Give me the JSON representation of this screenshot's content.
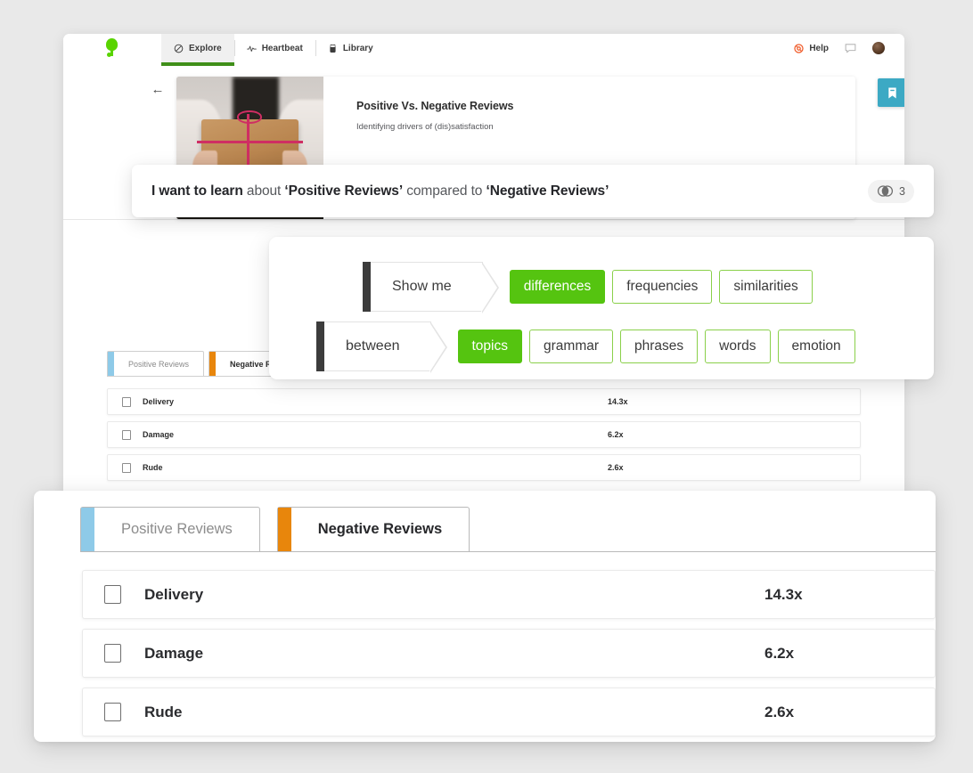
{
  "topnav": {
    "logo_name": "thematic-logo",
    "tabs": [
      {
        "label": "Explore",
        "icon": "explore-icon",
        "active": true
      },
      {
        "label": "Heartbeat",
        "icon": "heartbeat-icon",
        "active": false
      },
      {
        "label": "Library",
        "icon": "library-icon",
        "active": false
      }
    ],
    "help_label": "Help",
    "help_icon": "help-lifebuoy-icon",
    "feedback_icon": "chat-bubble-icon",
    "avatar_name": "user-avatar"
  },
  "hero": {
    "back_icon": "back-arrow-icon",
    "thumbnail_name": "hands-holding-wrapped-parcel-photo",
    "title": "Positive Vs. Negative Reviews",
    "subtitle": "Identifying drivers of (dis)satisfaction",
    "bookmark_icon": "bookmark-icon"
  },
  "query": {
    "lead": "I want to learn",
    "mid1": " about ",
    "term1": "‘Positive Reviews’",
    "mid2": " compared to ",
    "term2": "‘Negative Reviews’",
    "badge_icon": "venn-diagram-icon",
    "badge_count": "3"
  },
  "filters": {
    "rows": [
      {
        "lead": "Show me",
        "options": [
          {
            "label": "differences",
            "active": true
          },
          {
            "label": "frequencies",
            "active": false
          },
          {
            "label": "similarities",
            "active": false
          }
        ]
      },
      {
        "lead": "between",
        "options": [
          {
            "label": "topics",
            "active": true
          },
          {
            "label": "grammar",
            "active": false
          },
          {
            "label": "phrases",
            "active": false
          },
          {
            "label": "words",
            "active": false
          },
          {
            "label": "emotion",
            "active": false
          }
        ]
      }
    ]
  },
  "results": {
    "tabs": [
      {
        "label": "Positive Reviews",
        "color": "#8ecae8",
        "selected": false
      },
      {
        "label": "Negative Reviews",
        "color": "#e8860c",
        "selected": true
      }
    ],
    "rows": [
      {
        "label": "Delivery",
        "value": "14.3x"
      },
      {
        "label": "Damage",
        "value": "6.2x"
      },
      {
        "label": "Rude",
        "value": "2.6x"
      }
    ]
  },
  "colors": {
    "brand_green": "#62c80b",
    "pill_green": "#55c410",
    "pill_border_green": "#8ad04a",
    "tab_underline_green": "#3f8f19",
    "bookmark_teal": "#3ca9c4",
    "help_orange": "#f05a28",
    "positive_blue": "#8ecae8",
    "negative_orange": "#e8860c",
    "page_background": "#e9e9e9"
  }
}
